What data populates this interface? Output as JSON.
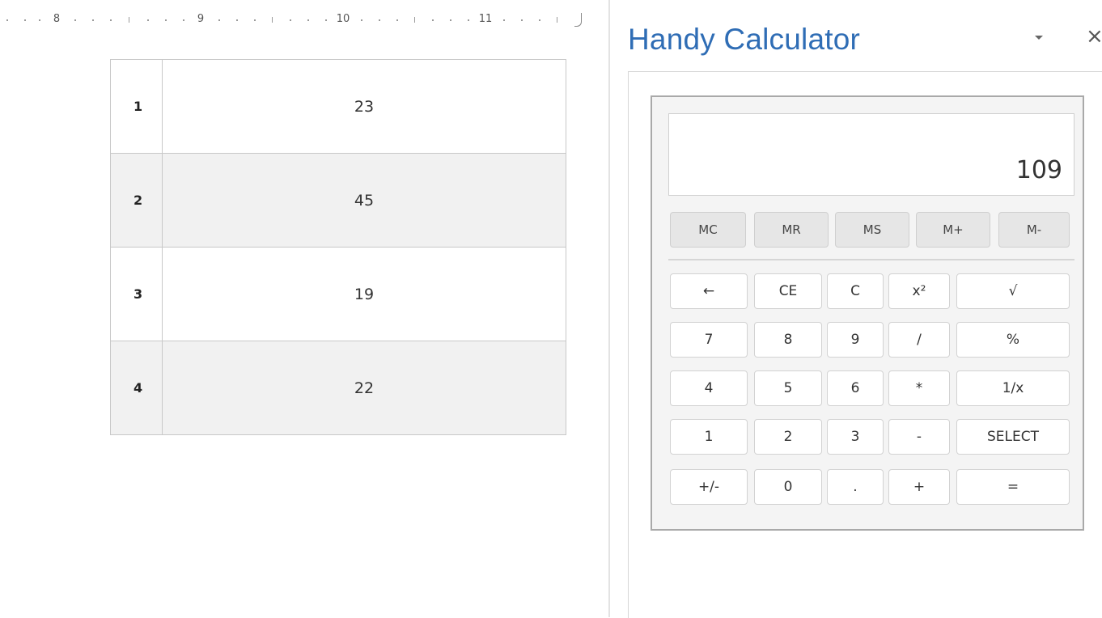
{
  "ruler": {
    "numbers": [
      "8",
      "9",
      "10",
      "11"
    ]
  },
  "table": {
    "rows": [
      {
        "index": "1",
        "value": "23"
      },
      {
        "index": "2",
        "value": "45"
      },
      {
        "index": "3",
        "value": "19"
      },
      {
        "index": "4",
        "value": "22"
      }
    ]
  },
  "pane": {
    "title": "Handy Calculator",
    "menu_icon": "dropdown-arrow-icon",
    "close_label": "×"
  },
  "calculator": {
    "display": "109",
    "memory": [
      "MC",
      "MR",
      "MS",
      "M+",
      "M-"
    ],
    "rows": [
      [
        "←",
        "CE",
        "C",
        "x²",
        "√"
      ],
      [
        "7",
        "8",
        "9",
        "/",
        "%"
      ],
      [
        "4",
        "5",
        "6",
        "*",
        "1/x"
      ],
      [
        "1",
        "2",
        "3",
        "-",
        "SELECT"
      ],
      [
        "+/-",
        "0",
        ".",
        "+",
        "="
      ]
    ]
  }
}
